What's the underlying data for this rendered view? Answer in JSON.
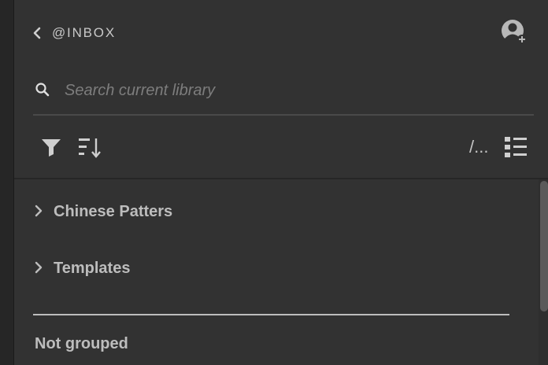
{
  "header": {
    "title": "@INBOX",
    "back_icon": "chevron-left-icon",
    "user_icon": "add-user-icon"
  },
  "search": {
    "placeholder": "Search current library",
    "value": "",
    "icon": "search-icon"
  },
  "toolbar": {
    "filter_icon": "filter-icon",
    "sort_icon": "sort-icon",
    "path_text": "/...",
    "list_view_icon": "list-view-icon"
  },
  "groups": [
    {
      "label": "Chinese Patters"
    },
    {
      "label": "Templates"
    }
  ],
  "not_grouped": {
    "label": "Not grouped"
  },
  "colors": {
    "panel_bg": "#323232",
    "text": "#bdbdbd",
    "placeholder": "#7d7d7d"
  }
}
